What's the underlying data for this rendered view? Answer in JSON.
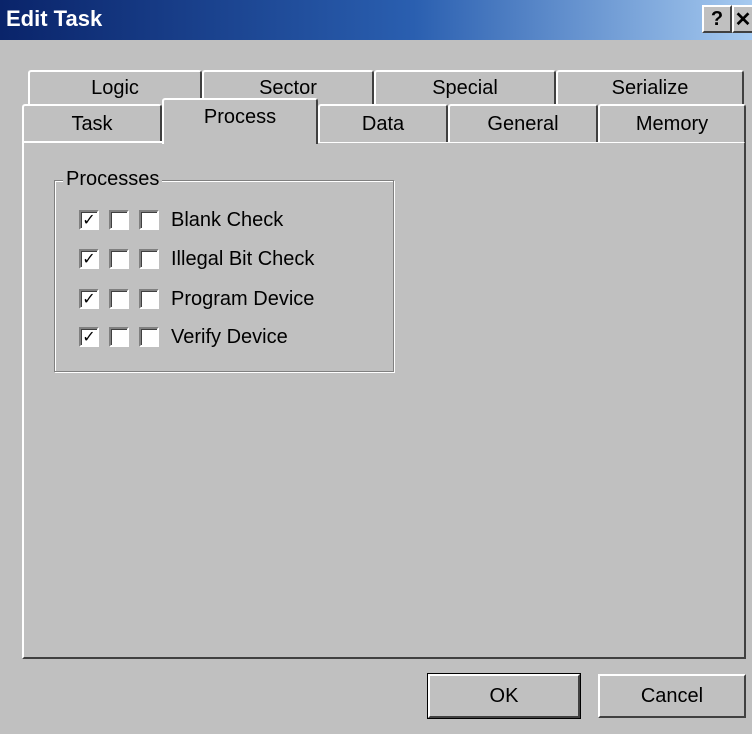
{
  "window": {
    "title": "Edit Task",
    "help_glyph": "?",
    "close_glyph": "✕"
  },
  "tabs": {
    "row1": [
      {
        "label": "Logic"
      },
      {
        "label": "Sector"
      },
      {
        "label": "Special"
      },
      {
        "label": "Serialize"
      }
    ],
    "row2": [
      {
        "label": "Task"
      },
      {
        "label": "Process",
        "active": true
      },
      {
        "label": "Data"
      },
      {
        "label": "General"
      },
      {
        "label": "Memory"
      }
    ]
  },
  "processes": {
    "group_label": "Processes",
    "items": [
      {
        "label": "Blank Check",
        "checks": [
          true,
          false,
          false
        ]
      },
      {
        "label": "Illegal Bit Check",
        "checks": [
          true,
          false,
          false
        ]
      },
      {
        "label": "Program Device",
        "checks": [
          true,
          false,
          false
        ]
      },
      {
        "label": "Verify Device",
        "checks": [
          true,
          false,
          false
        ]
      }
    ]
  },
  "buttons": {
    "ok_label": "OK",
    "cancel_label": "Cancel"
  },
  "glyphs": {
    "check": "✓"
  }
}
